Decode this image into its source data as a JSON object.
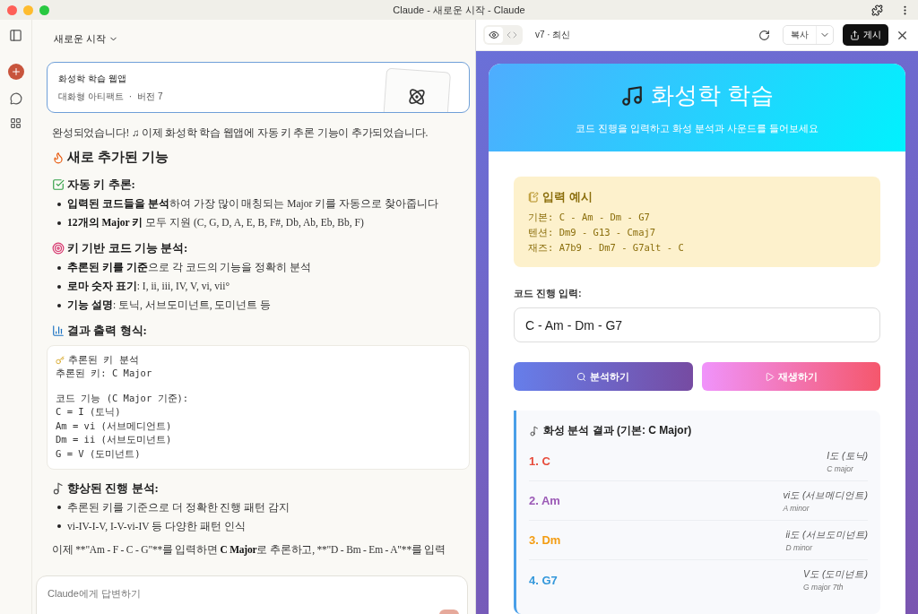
{
  "window": {
    "title": "Claude - 새로운 시작 - Claude"
  },
  "chat": {
    "header": "새로운 시작",
    "artifact": {
      "title": "화성학 학습 웹앱",
      "kind_label": "대화형 아티팩트",
      "separator": "·",
      "version": "버전 7"
    },
    "blocks": [
      {
        "kind": "para",
        "parts": [
          {
            "text": "완성되었습니다! ",
            "bold": false
          },
          {
            "text": "♫",
            "bold": false
          },
          {
            "text": " 이제 화성학 학습 웹앱에 자동 키 추론 기능이 추가되었습니다.",
            "bold": false
          }
        ]
      },
      {
        "kind": "h2",
        "text": "새로 추가된 기능"
      },
      {
        "kind": "h3",
        "text": "자동 키 추론:"
      },
      {
        "kind": "bullet",
        "parts": [
          {
            "text": "입력된 코드들을 분석",
            "bold": true
          },
          {
            "text": "하여 가장 많이 매칭되는 Major 키를 자동으로 찾아줍니다",
            "bold": false
          }
        ]
      },
      {
        "kind": "bullet",
        "parts": [
          {
            "text": "12개의 Major 키",
            "bold": true
          },
          {
            "text": " 모두 지원 (C, G, D, A, E, B, F#, Db, Ab, Eb, Bb, F)",
            "bold": false
          }
        ]
      },
      {
        "kind": "h3",
        "text": "키 기반 코드 기능 분석:"
      },
      {
        "kind": "bullet",
        "parts": [
          {
            "text": "추론된 키를 기준",
            "bold": true
          },
          {
            "text": "으로 각 코드의 기능을 정확히 분석",
            "bold": false
          }
        ]
      },
      {
        "kind": "bullet",
        "parts": [
          {
            "text": "로마 숫자 표기",
            "bold": true
          },
          {
            "text": ": I, ii, iii, IV, V, vi, vii°",
            "bold": false
          }
        ]
      },
      {
        "kind": "bullet",
        "parts": [
          {
            "text": "기능 설명",
            "bold": true
          },
          {
            "text": ": 토닉, 서브도미넌트, 도미넌트 등",
            "bold": false
          }
        ]
      },
      {
        "kind": "h3",
        "text": "결과 출력 형식:"
      },
      {
        "kind": "code",
        "groups": [
          [
            "추론된 키 분석",
            "추론된 키: C Major"
          ],
          [
            "코드 기능 (C Major 기준):",
            "C = I (토닉)",
            "Am = vi (서브메디언트)",
            "Dm = ii (서브도미넌트)",
            "G = V (도미넌트)"
          ]
        ]
      },
      {
        "kind": "h3",
        "text": "향상된 진행 분석:"
      },
      {
        "kind": "bullet",
        "parts": [
          {
            "text": "추론된 키를 기준으로 더 정확한 진행 패턴 감지",
            "bold": false
          }
        ]
      },
      {
        "kind": "bullet",
        "parts": [
          {
            "text": "vi-IV-I-V, I-V-vi-IV 등 다양한 패턴 인식",
            "bold": false
          }
        ]
      },
      {
        "kind": "para",
        "parts": [
          {
            "text": "이제 **\"Am - F - C - G\"**를 입력하면 ",
            "bold": false
          },
          {
            "text": "C Major",
            "bold": true
          },
          {
            "text": "로 추론하고, **\"D - Bm - Em - A\"**를 입력",
            "bold": false
          }
        ]
      }
    ],
    "reply": {
      "placeholder": "Claude에게 답변하기"
    }
  },
  "artifact_panel": {
    "view_toggle": [
      {
        "kind": "preview",
        "selected": true
      },
      {
        "kind": "code",
        "selected": false
      }
    ],
    "version": "v7 · 최신",
    "copy": "복사",
    "publish": "게시",
    "app": {
      "title": "화성학 학습",
      "subtitle": "코드 진행을 입력하고 화성 분석과 사운드를 들어보세요",
      "examples": {
        "title": "입력 예시",
        "lines": [
          "기본: C - Am - Dm - G7",
          "텐션: Dm9 - G13 - Cmaj7",
          "재즈: A7b9 - Dm7 - G7alt - C"
        ]
      },
      "input_label": "코드 진행 입력:",
      "input_value": "C - Am - Dm - G7",
      "analyze": "분석하기",
      "play": "재생하기",
      "result": {
        "title": "화성 분석 결과 (기본: C Major)",
        "chords": [
          {
            "name": "1. C",
            "color": "#e74c3c",
            "function": "I도 (토닉)",
            "quality": "C major"
          },
          {
            "name": "2. Am",
            "color": "#9b59b6",
            "function": "vi도 (서브메디언트)",
            "quality": "A minor"
          },
          {
            "name": "3. Dm",
            "color": "#f39c12",
            "function": "ii도 (서브도미넌트)",
            "quality": "D minor"
          },
          {
            "name": "4. G7",
            "color": "#3498db",
            "function": "V도 (도미넌트)",
            "quality": "G major 7th"
          }
        ]
      }
    }
  }
}
